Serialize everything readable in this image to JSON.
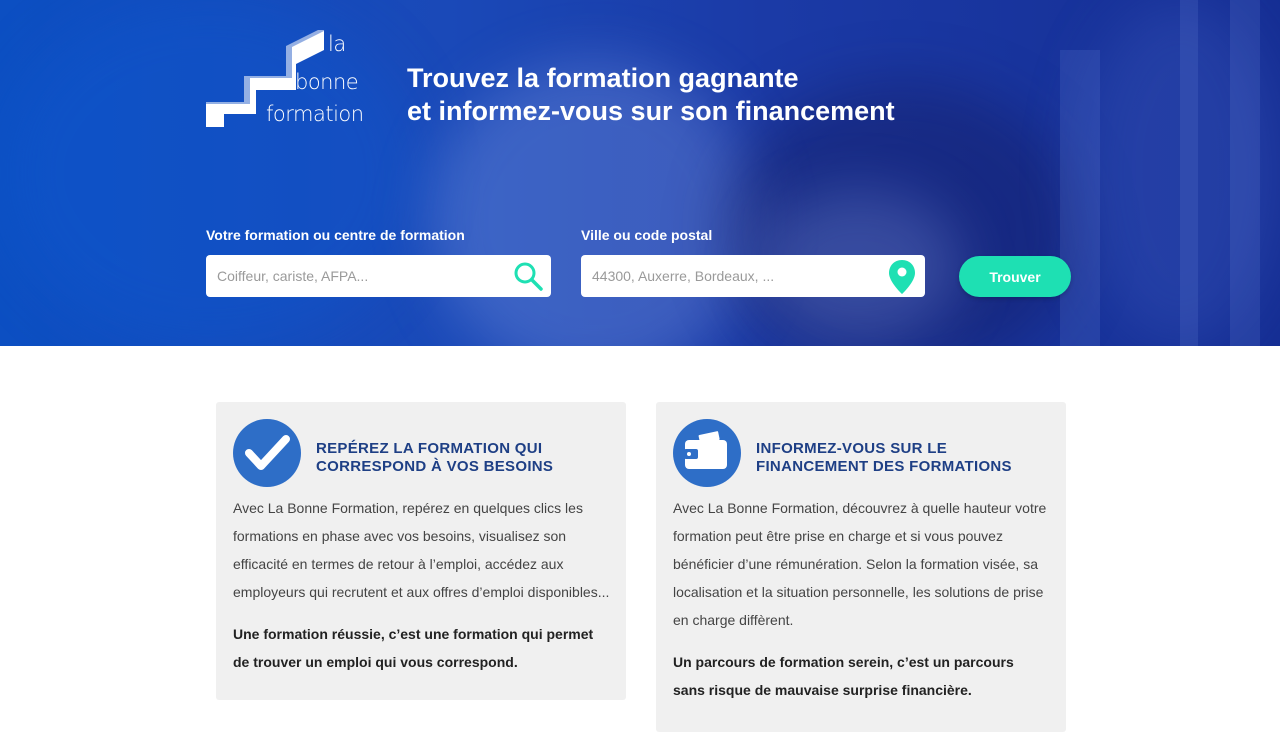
{
  "brand": {
    "line1": "la",
    "line2": "bonne",
    "line3": "formation"
  },
  "tagline": {
    "a1": "Trouvez la ",
    "b1": "formation gagnante",
    "a2": "et ",
    "b2": "informez-vous",
    "a3": " sur son ",
    "b3": "financement"
  },
  "search": {
    "formation_label": "Votre formation ou centre de formation",
    "formation_placeholder": "Coiffeur, cariste, AFPA...",
    "formation_icon": "search-icon",
    "location_label": "Ville ou code postal",
    "location_placeholder": "44300, Auxerre, Bordeaux, ...",
    "location_icon": "location-pin-icon",
    "submit_label": "Trouver"
  },
  "cards": [
    {
      "icon": "checkmark-icon",
      "title_line1": "REPÉREZ LA FORMATION QUI",
      "title_line2": "CORRESPOND À VOS BESOINS",
      "lines": [
        "Avec La Bonne Formation, repérez en quelques clics les",
        "formations en phase avec vos besoins, visualisez son",
        "efficacité en termes de retour à l’emploi, accédez aux",
        "employeurs qui recrutent et aux offres d’emploi disponibles..."
      ],
      "bold_lines": [
        "Une formation réussie, c’est une formation qui permet",
        "de trouver un emploi qui vous correspond."
      ]
    },
    {
      "icon": "wallet-icon",
      "title_line1": "INFORMEZ-VOUS SUR LE",
      "title_line2": "FINANCEMENT DES FORMATIONS",
      "lines": [
        "Avec La Bonne Formation, découvrez à quelle hauteur votre",
        "formation peut être prise en charge et si vous pouvez",
        "bénéficier d’une rémunération. Selon la formation visée, sa",
        "localisation et la situation personnelle, les solutions de prise",
        "en charge diffèrent."
      ],
      "bold_lines": [
        "Un parcours de formation serein, c’est un parcours",
        "sans risque de mauvaise surprise financière."
      ]
    }
  ],
  "colors": {
    "accent": "#1ee0b3",
    "primary_blue": "#2e6ec7",
    "title_blue": "#1e3f85",
    "card_bg": "#f0f0f0"
  }
}
